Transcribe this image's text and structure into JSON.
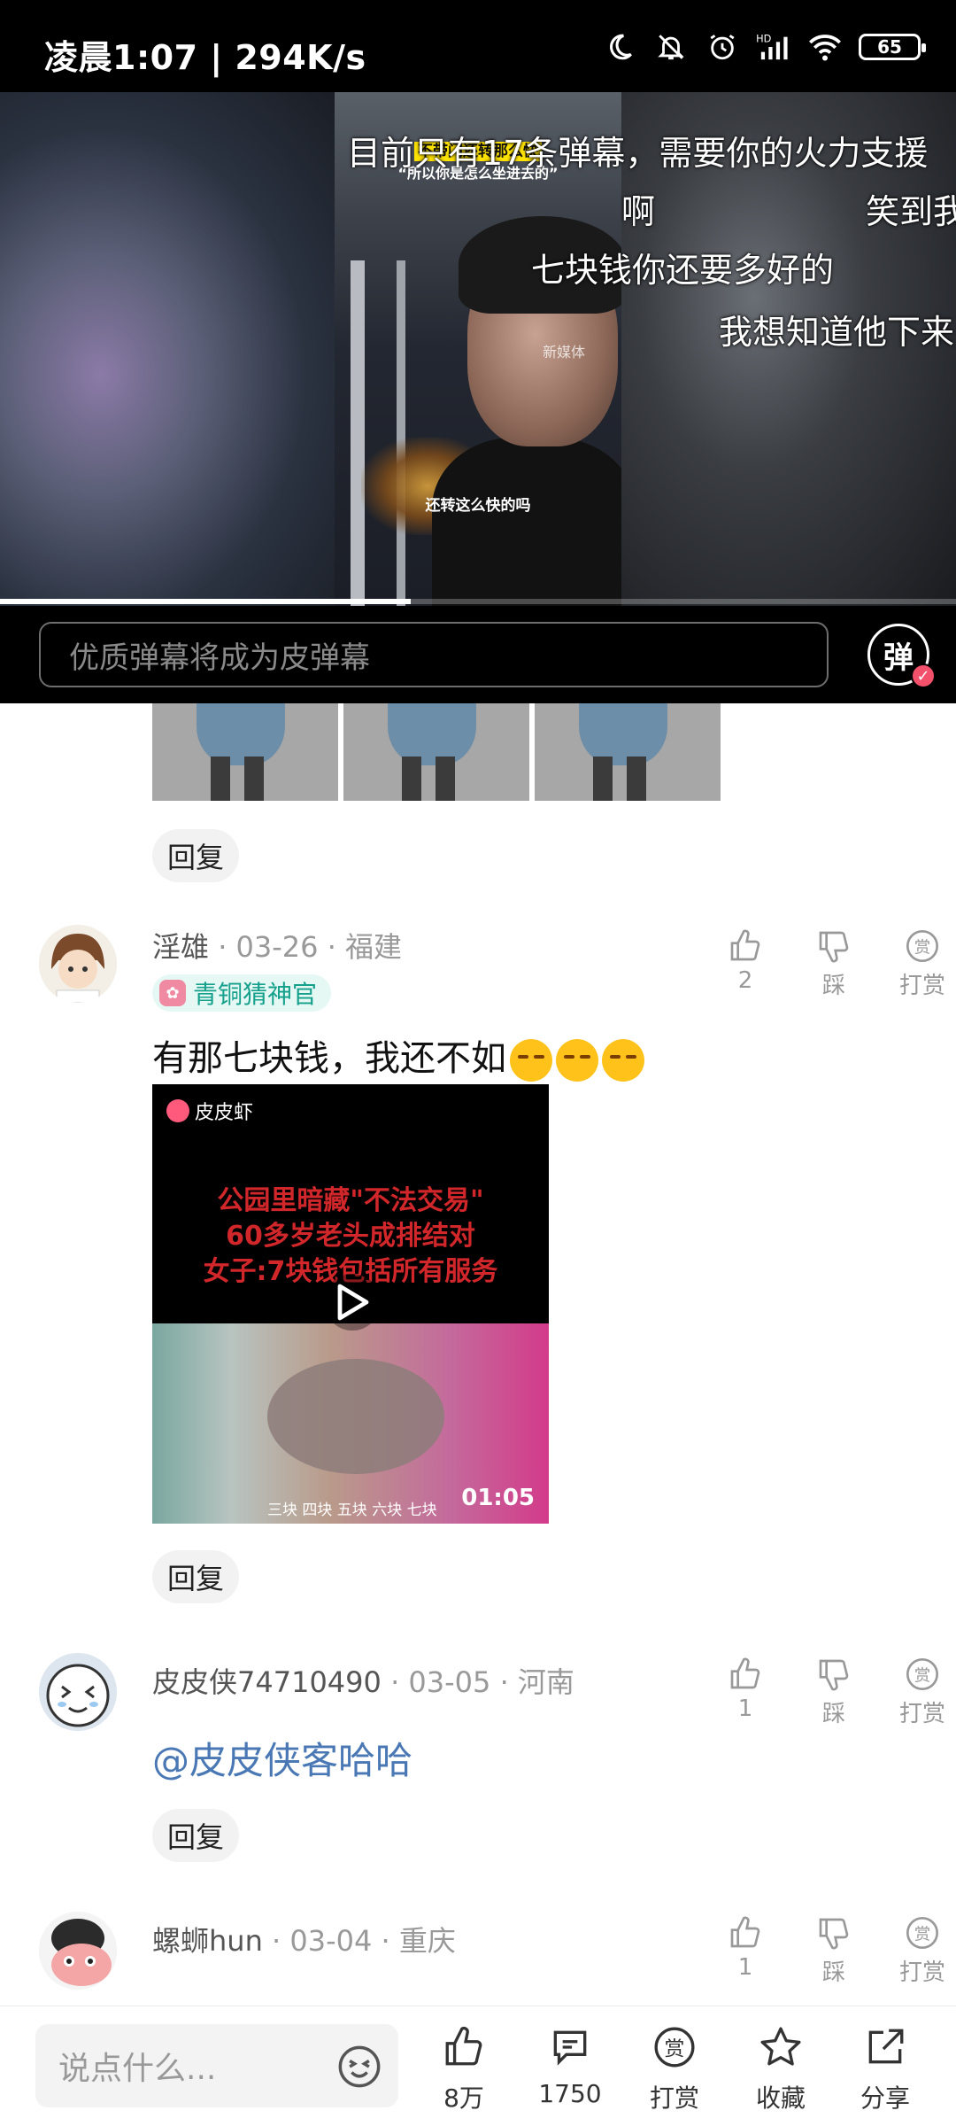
{
  "status_bar": {
    "time": "凌晨1:07 | 294K/s",
    "battery": "65",
    "icons": [
      "moon-icon",
      "mute-bell-icon",
      "alarm-icon",
      "signal-hd-icon",
      "wifi-icon",
      "battery-icon"
    ]
  },
  "video": {
    "caption_top": "不带门还转那么快",
    "caption_sub": "“所以你是怎么坐进去的”",
    "watermark": "新媒体",
    "caption_bottom": "还转这么快的吗",
    "progress": 0.43,
    "danmaku": [
      "目前只有17条弹幕，需要你的火力支援",
      "啊",
      "笑到我",
      "七块钱你还要多好的",
      "我想知道他下来"
    ]
  },
  "danmaku_bar": {
    "placeholder": "优质弹幕将成为皮弹幕",
    "toggle_label": "弹"
  },
  "comments": [
    {
      "name": "淫雄",
      "date": "· 03-26 · 福建",
      "badge": "青铜猜神官",
      "text": "有那七块钱，我还不如",
      "likes": "2",
      "dislike_label": "踩",
      "tip_label": "打赏",
      "video": {
        "app_label": "皮皮虾",
        "headline_lines": [
          "公园里暗藏\"不法交易\"",
          "60多岁老头成排结对",
          "女子:7块钱包括所有服务"
        ],
        "scale_text": "三块  四块  五块  六块  七块",
        "duration": "01:05"
      }
    },
    {
      "name": "皮皮侠74710490",
      "date": "· 03-05 · 河南",
      "mention": "@皮皮侠客哈哈",
      "likes": "1",
      "dislike_label": "踩",
      "tip_label": "打赏"
    },
    {
      "name": "螺蛳hun",
      "date": "· 03-04 · 重庆",
      "likes": "1",
      "dislike_label": "踩",
      "tip_label": "打赏"
    }
  ],
  "reply_label": "回复",
  "bottom_bar": {
    "input_placeholder": "说点什么...",
    "like_count": "8万",
    "comment_count": "1750",
    "tip_label": "打赏",
    "favorite_label": "收藏",
    "share_label": "分享"
  }
}
